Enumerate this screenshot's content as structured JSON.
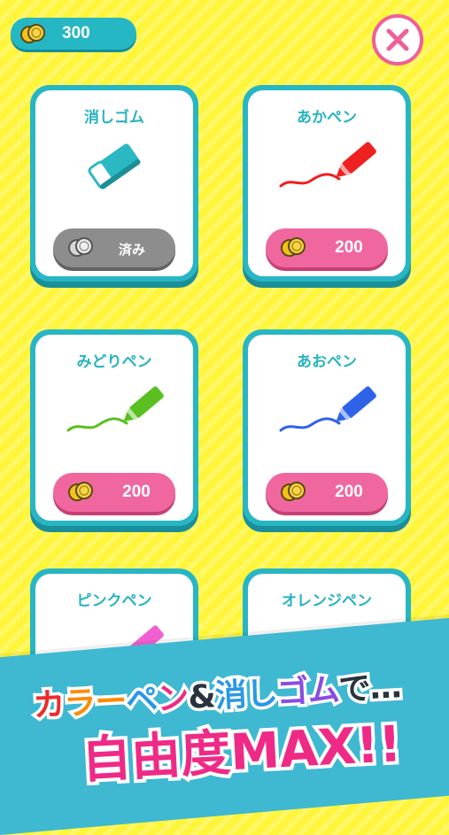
{
  "coins": {
    "count": "300"
  },
  "items": [
    {
      "name": "消しゴム",
      "price": "済み",
      "purchased": true,
      "icon": "eraser-icon"
    },
    {
      "name": "あかペン",
      "price": "200",
      "purchased": false,
      "icon": "red-pen-icon",
      "color": "#ef2020"
    },
    {
      "name": "みどりペン",
      "price": "200",
      "purchased": false,
      "icon": "green-pen-icon",
      "color": "#59c01f"
    },
    {
      "name": "あおペン",
      "price": "200",
      "purchased": false,
      "icon": "blue-pen-icon",
      "color": "#2e63e8"
    },
    {
      "name": "ピンクペン",
      "price": "",
      "purchased": false,
      "icon": "pink-pen-icon",
      "color": "#f25fd0"
    },
    {
      "name": "オレンジペン",
      "price": "",
      "purchased": false,
      "icon": "orange-pen-icon",
      "color": "#ff9a12"
    }
  ],
  "banner": {
    "line1_parts": [
      "カ",
      "ラ",
      "ー",
      "ペ",
      "ン",
      "&",
      "消",
      "し",
      "ゴ",
      "ム",
      "で…"
    ],
    "line2": "自由度MAX!!"
  },
  "colors": {
    "background": "#fff53a",
    "card": "#28b6c4",
    "button_pink": "#f0679f",
    "button_gray": "#8d8d8d"
  }
}
